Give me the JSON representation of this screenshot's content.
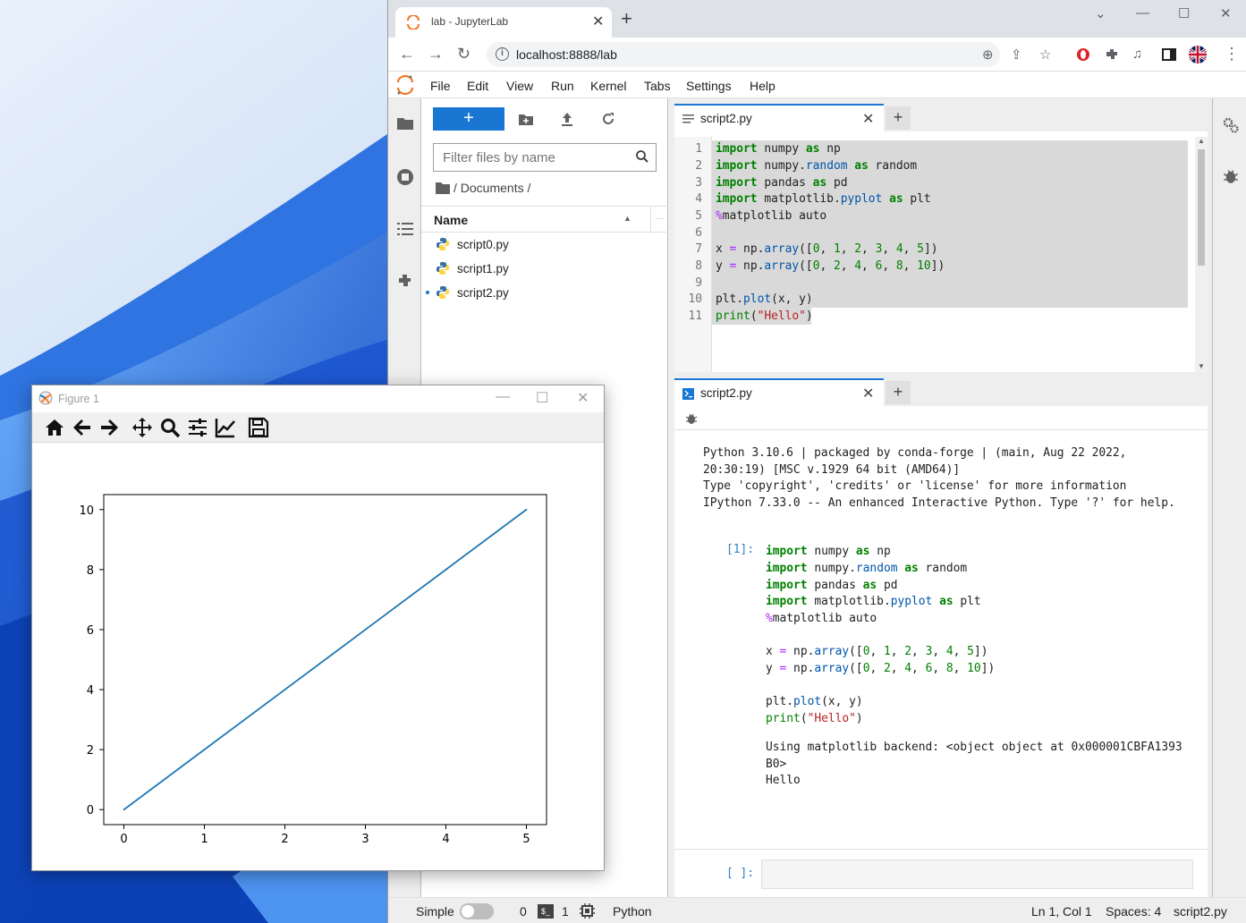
{
  "browser": {
    "tab_title": "lab - JupyterLab",
    "url": "localhost:8888/lab"
  },
  "menu": [
    "File",
    "Edit",
    "View",
    "Run",
    "Kernel",
    "Tabs",
    "Settings",
    "Help"
  ],
  "filebrowser": {
    "filter_placeholder": "Filter files by name",
    "breadcrumb": "/ Documents /",
    "column_name": "Name",
    "files": [
      "script0.py",
      "script1.py",
      "script2.py"
    ]
  },
  "editor": {
    "tab_label": "script2.py",
    "line_numbers": [
      "1",
      "2",
      "3",
      "4",
      "5",
      "6",
      "7",
      "8",
      "9",
      "10",
      "11"
    ]
  },
  "console": {
    "tab_label": "script2.py",
    "banner": [
      "Python 3.10.6 | packaged by conda-forge | (main, Aug 22 2022,",
      "20:30:19) [MSC v.1929 64 bit (AMD64)]",
      "Type 'copyright', 'credits' or 'license' for more information",
      "IPython 7.33.0 -- An enhanced Interactive Python. Type '?' for help."
    ],
    "in_prompt": "[1]:",
    "output": [
      "Using matplotlib backend: <object object at 0x000001CBFA1393",
      "B0>",
      "Hello"
    ],
    "empty_prompt": "[ ]:"
  },
  "statusbar": {
    "mode": "Simple",
    "terminals": "0",
    "kernels": "1",
    "kernel_name": "Python",
    "position": "Ln 1, Col 1",
    "spaces": "Spaces: 4",
    "file": "script2.py"
  },
  "figure": {
    "window_title": "Figure 1"
  },
  "chart_data": {
    "type": "line",
    "x": [
      0,
      1,
      2,
      3,
      4,
      5
    ],
    "series": [
      {
        "values": [
          0,
          2,
          4,
          6,
          8,
          10
        ]
      }
    ],
    "xlim": [
      -0.25,
      5.25
    ],
    "ylim": [
      -0.5,
      10.5
    ],
    "xticks": [
      "0",
      "1",
      "2",
      "3",
      "4",
      "5"
    ],
    "yticks": [
      "0",
      "2",
      "4",
      "6",
      "8",
      "10"
    ],
    "line_color": "#1f77b4",
    "title": "",
    "xlabel": "",
    "ylabel": ""
  },
  "colors": {
    "accent": "#1976d2",
    "keyword": "#008000",
    "string": "#ba2121"
  }
}
